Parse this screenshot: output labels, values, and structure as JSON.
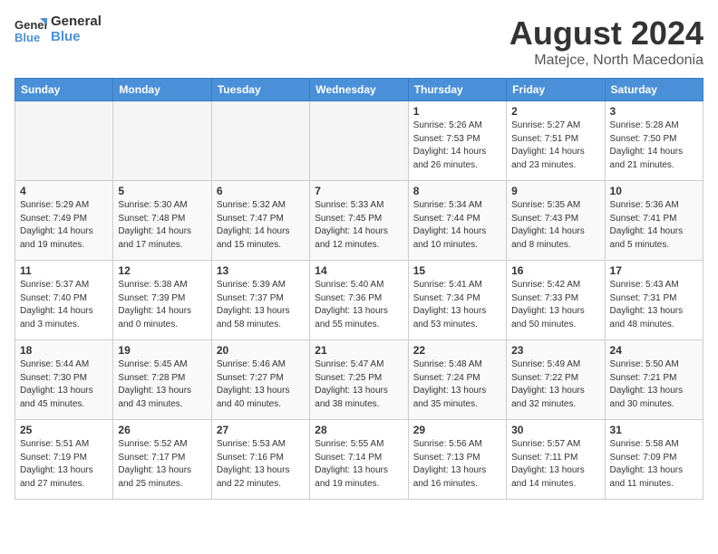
{
  "header": {
    "logo_line1": "General",
    "logo_line2": "Blue",
    "month": "August 2024",
    "location": "Matejce, North Macedonia"
  },
  "days_of_week": [
    "Sunday",
    "Monday",
    "Tuesday",
    "Wednesday",
    "Thursday",
    "Friday",
    "Saturday"
  ],
  "weeks": [
    [
      {
        "day": "",
        "empty": true
      },
      {
        "day": "",
        "empty": true
      },
      {
        "day": "",
        "empty": true
      },
      {
        "day": "",
        "empty": true
      },
      {
        "day": "1",
        "info": "Sunrise: 5:26 AM\nSunset: 7:53 PM\nDaylight: 14 hours\nand 26 minutes."
      },
      {
        "day": "2",
        "info": "Sunrise: 5:27 AM\nSunset: 7:51 PM\nDaylight: 14 hours\nand 23 minutes."
      },
      {
        "day": "3",
        "info": "Sunrise: 5:28 AM\nSunset: 7:50 PM\nDaylight: 14 hours\nand 21 minutes."
      }
    ],
    [
      {
        "day": "4",
        "info": "Sunrise: 5:29 AM\nSunset: 7:49 PM\nDaylight: 14 hours\nand 19 minutes."
      },
      {
        "day": "5",
        "info": "Sunrise: 5:30 AM\nSunset: 7:48 PM\nDaylight: 14 hours\nand 17 minutes."
      },
      {
        "day": "6",
        "info": "Sunrise: 5:32 AM\nSunset: 7:47 PM\nDaylight: 14 hours\nand 15 minutes."
      },
      {
        "day": "7",
        "info": "Sunrise: 5:33 AM\nSunset: 7:45 PM\nDaylight: 14 hours\nand 12 minutes."
      },
      {
        "day": "8",
        "info": "Sunrise: 5:34 AM\nSunset: 7:44 PM\nDaylight: 14 hours\nand 10 minutes."
      },
      {
        "day": "9",
        "info": "Sunrise: 5:35 AM\nSunset: 7:43 PM\nDaylight: 14 hours\nand 8 minutes."
      },
      {
        "day": "10",
        "info": "Sunrise: 5:36 AM\nSunset: 7:41 PM\nDaylight: 14 hours\nand 5 minutes."
      }
    ],
    [
      {
        "day": "11",
        "info": "Sunrise: 5:37 AM\nSunset: 7:40 PM\nDaylight: 14 hours\nand 3 minutes."
      },
      {
        "day": "12",
        "info": "Sunrise: 5:38 AM\nSunset: 7:39 PM\nDaylight: 14 hours\nand 0 minutes."
      },
      {
        "day": "13",
        "info": "Sunrise: 5:39 AM\nSunset: 7:37 PM\nDaylight: 13 hours\nand 58 minutes."
      },
      {
        "day": "14",
        "info": "Sunrise: 5:40 AM\nSunset: 7:36 PM\nDaylight: 13 hours\nand 55 minutes."
      },
      {
        "day": "15",
        "info": "Sunrise: 5:41 AM\nSunset: 7:34 PM\nDaylight: 13 hours\nand 53 minutes."
      },
      {
        "day": "16",
        "info": "Sunrise: 5:42 AM\nSunset: 7:33 PM\nDaylight: 13 hours\nand 50 minutes."
      },
      {
        "day": "17",
        "info": "Sunrise: 5:43 AM\nSunset: 7:31 PM\nDaylight: 13 hours\nand 48 minutes."
      }
    ],
    [
      {
        "day": "18",
        "info": "Sunrise: 5:44 AM\nSunset: 7:30 PM\nDaylight: 13 hours\nand 45 minutes."
      },
      {
        "day": "19",
        "info": "Sunrise: 5:45 AM\nSunset: 7:28 PM\nDaylight: 13 hours\nand 43 minutes."
      },
      {
        "day": "20",
        "info": "Sunrise: 5:46 AM\nSunset: 7:27 PM\nDaylight: 13 hours\nand 40 minutes."
      },
      {
        "day": "21",
        "info": "Sunrise: 5:47 AM\nSunset: 7:25 PM\nDaylight: 13 hours\nand 38 minutes."
      },
      {
        "day": "22",
        "info": "Sunrise: 5:48 AM\nSunset: 7:24 PM\nDaylight: 13 hours\nand 35 minutes."
      },
      {
        "day": "23",
        "info": "Sunrise: 5:49 AM\nSunset: 7:22 PM\nDaylight: 13 hours\nand 32 minutes."
      },
      {
        "day": "24",
        "info": "Sunrise: 5:50 AM\nSunset: 7:21 PM\nDaylight: 13 hours\nand 30 minutes."
      }
    ],
    [
      {
        "day": "25",
        "info": "Sunrise: 5:51 AM\nSunset: 7:19 PM\nDaylight: 13 hours\nand 27 minutes."
      },
      {
        "day": "26",
        "info": "Sunrise: 5:52 AM\nSunset: 7:17 PM\nDaylight: 13 hours\nand 25 minutes."
      },
      {
        "day": "27",
        "info": "Sunrise: 5:53 AM\nSunset: 7:16 PM\nDaylight: 13 hours\nand 22 minutes."
      },
      {
        "day": "28",
        "info": "Sunrise: 5:55 AM\nSunset: 7:14 PM\nDaylight: 13 hours\nand 19 minutes."
      },
      {
        "day": "29",
        "info": "Sunrise: 5:56 AM\nSunset: 7:13 PM\nDaylight: 13 hours\nand 16 minutes."
      },
      {
        "day": "30",
        "info": "Sunrise: 5:57 AM\nSunset: 7:11 PM\nDaylight: 13 hours\nand 14 minutes."
      },
      {
        "day": "31",
        "info": "Sunrise: 5:58 AM\nSunset: 7:09 PM\nDaylight: 13 hours\nand 11 minutes."
      }
    ]
  ]
}
